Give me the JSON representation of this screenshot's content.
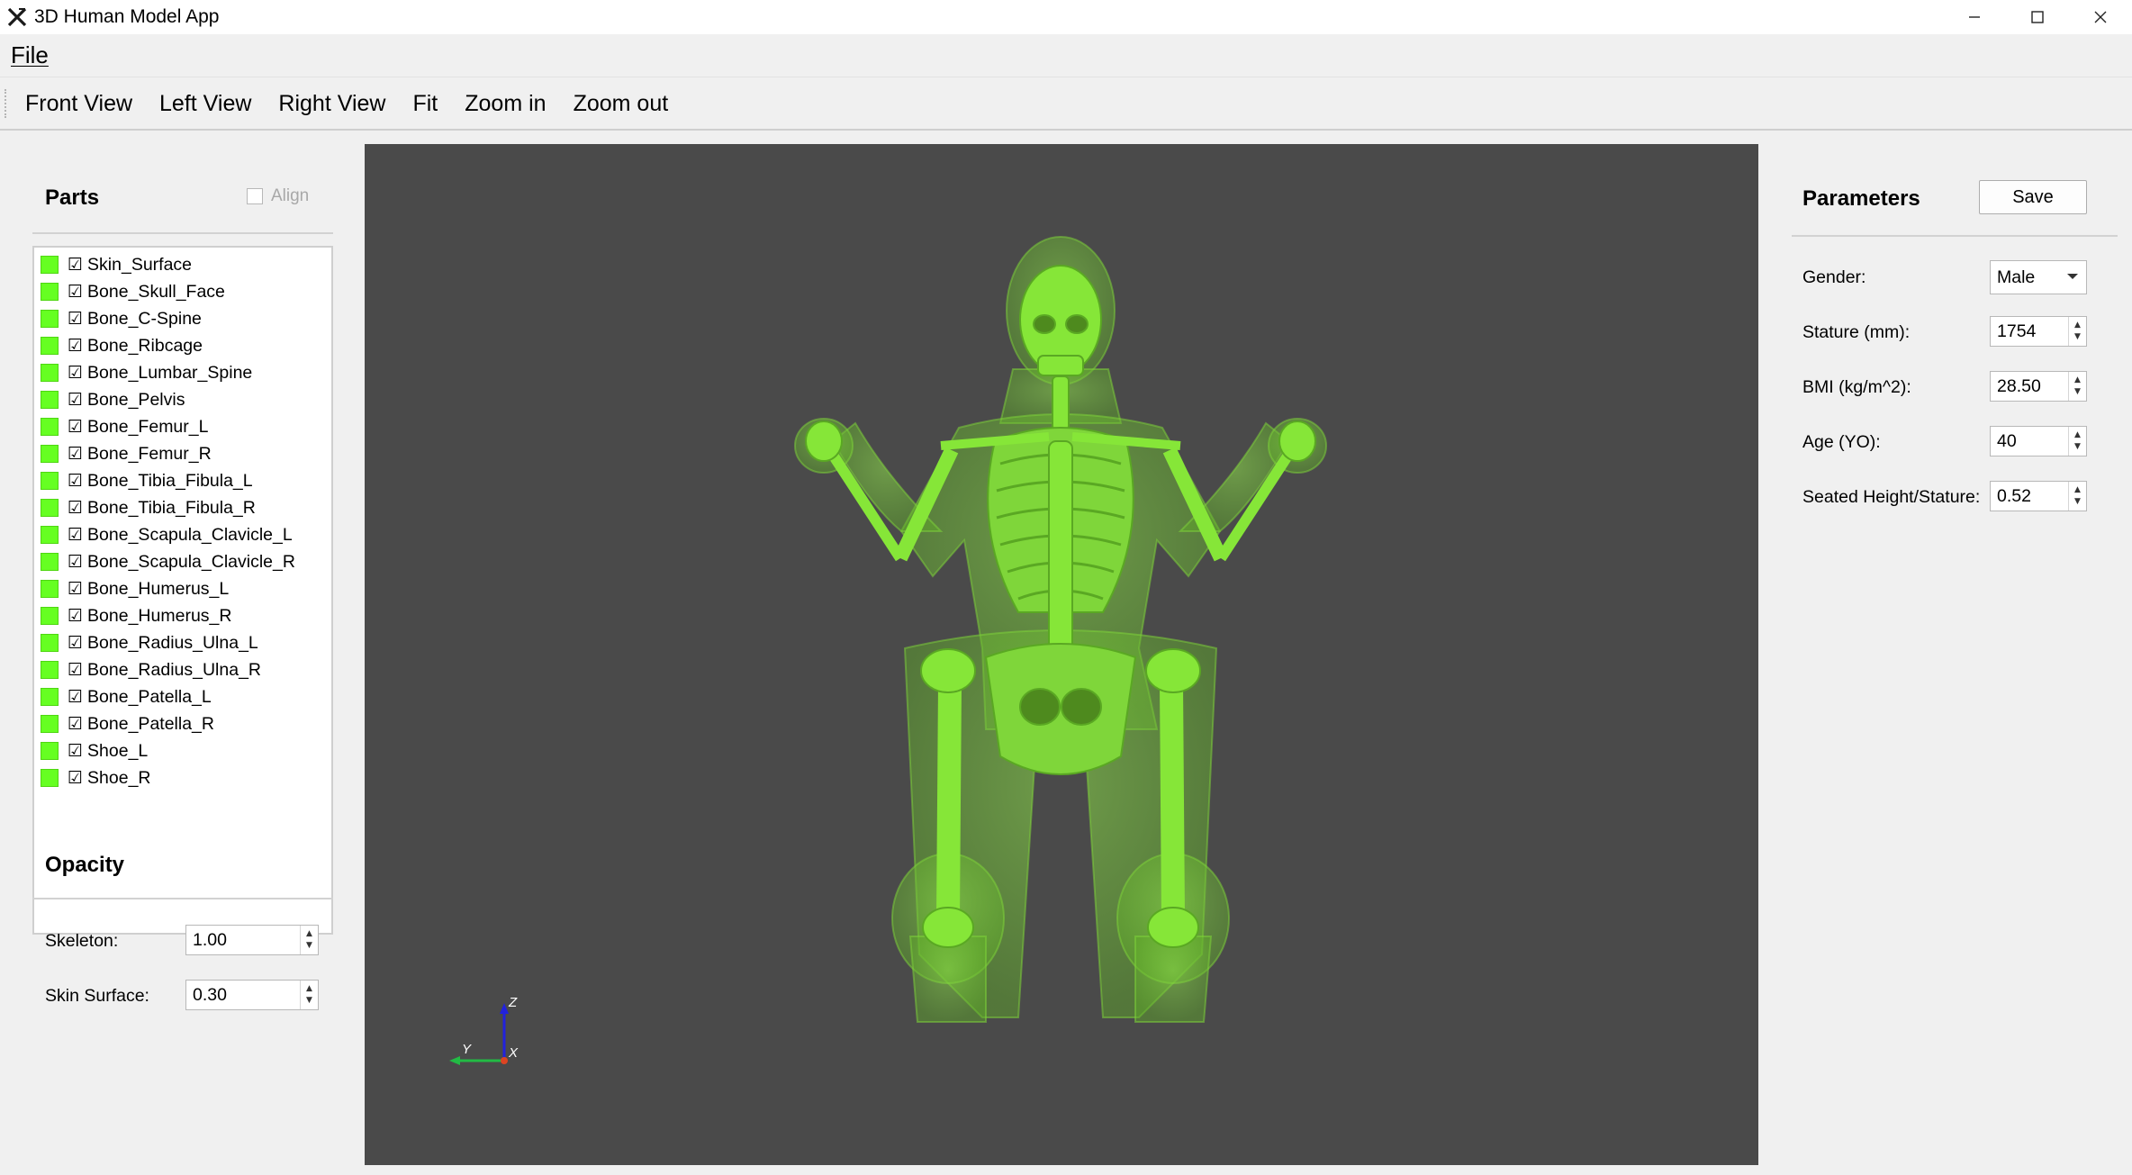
{
  "window": {
    "title": "3D Human Model App",
    "icon": "app-x-icon",
    "controls": [
      "minimize-icon",
      "maximize-icon",
      "close-icon"
    ]
  },
  "menu": {
    "file": "File"
  },
  "toolbar": {
    "buttons": [
      "Front View",
      "Left View",
      "Right View",
      "Fit",
      "Zoom in",
      "Zoom out"
    ]
  },
  "parts_panel": {
    "title": "Parts",
    "align_label": "Align",
    "align_checked": false,
    "swatch_color": "#66ff22",
    "items": [
      {
        "name": "Skin_Surface",
        "checked": true
      },
      {
        "name": "Bone_Skull_Face",
        "checked": true
      },
      {
        "name": "Bone_C-Spine",
        "checked": true
      },
      {
        "name": "Bone_Ribcage",
        "checked": true
      },
      {
        "name": "Bone_Lumbar_Spine",
        "checked": true
      },
      {
        "name": "Bone_Pelvis",
        "checked": true
      },
      {
        "name": "Bone_Femur_L",
        "checked": true
      },
      {
        "name": "Bone_Femur_R",
        "checked": true
      },
      {
        "name": "Bone_Tibia_Fibula_L",
        "checked": true
      },
      {
        "name": "Bone_Tibia_Fibula_R",
        "checked": true
      },
      {
        "name": "Bone_Scapula_Clavicle_L",
        "checked": true
      },
      {
        "name": "Bone_Scapula_Clavicle_R",
        "checked": true
      },
      {
        "name": "Bone_Humerus_L",
        "checked": true
      },
      {
        "name": "Bone_Humerus_R",
        "checked": true
      },
      {
        "name": "Bone_Radius_Ulna_L",
        "checked": true
      },
      {
        "name": "Bone_Radius_Ulna_R",
        "checked": true
      },
      {
        "name": "Bone_Patella_L",
        "checked": true
      },
      {
        "name": "Bone_Patella_R",
        "checked": true
      },
      {
        "name": "Shoe_L",
        "checked": true
      },
      {
        "name": "Shoe_R",
        "checked": true
      }
    ]
  },
  "opacity_panel": {
    "title": "Opacity",
    "skeleton_label": "Skeleton:",
    "skeleton_value": "1.00",
    "skin_label": "Skin Surface:",
    "skin_value": "0.30"
  },
  "viewport": {
    "background": "#4a4a4a",
    "model_color": "#7fd63a",
    "axes": {
      "z": "Z",
      "y": "Y",
      "x": "X"
    }
  },
  "parameters_panel": {
    "title": "Parameters",
    "save_label": "Save",
    "gender_label": "Gender:",
    "gender_value": "Male",
    "stature_label": "Stature (mm):",
    "stature_value": "1754",
    "bmi_label": "BMI (kg/m^2):",
    "bmi_value": "28.50",
    "age_label": "Age (YO):",
    "age_value": "40",
    "seated_label": "Seated Height/Stature:",
    "seated_value": "0.52"
  }
}
